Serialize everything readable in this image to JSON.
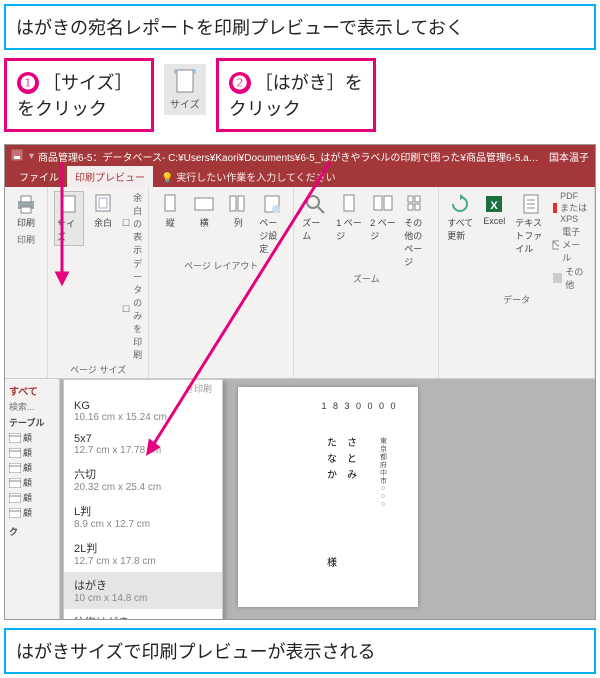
{
  "callouts": {
    "top": "はがきの宛名レポートを印刷プレビューで表示しておく",
    "a1_num": "❶",
    "a1_text": "［サイズ］をクリック",
    "a2_num": "❷",
    "a2_text": "［はがき］をクリック",
    "size_label": "サイズ",
    "bottom": "はがきサイズで印刷プレビューが表示される"
  },
  "titlebar": {
    "title": "商品管理6-5：データベース- C:¥Users¥Kaori¥Documents¥6-5_はがきやラベルの印刷で困った¥商品管理6-5.accdb…",
    "user": "国本温子"
  },
  "tabs": {
    "file": "ファイル",
    "preview": "印刷プレビュー",
    "tellme": "実行したい作業を入力してください"
  },
  "ribbon": {
    "print": "印刷",
    "size": "サイズ",
    "margin": "余白",
    "show_margin": "余白の表示",
    "print_data_only": "データのみを印刷",
    "portrait": "縦",
    "landscape": "横",
    "columns": "列",
    "page_setup": "ページ設定",
    "zoom": "ズーム",
    "one_page": "1 ページ",
    "two_pages": "2 ページ",
    "more_pages": "その他のページ",
    "refresh_all": "すべて更新",
    "excel": "Excel",
    "text_file": "テキストファイル",
    "pdf_xps": "PDF または XPS",
    "email": "電子メール",
    "other": "その他",
    "group_print": "印刷",
    "group_pagesize": "ページ サイズ",
    "group_layout": "ページ レイアウト",
    "group_zoom": "ズーム",
    "group_data": "データ"
  },
  "dd_header": "き印刷",
  "sizes": [
    {
      "name": "KG",
      "dim": "10.16 cm x 15.24 cm"
    },
    {
      "name": "5x7",
      "dim": "12.7 cm x 17.78 cm"
    },
    {
      "name": "六切",
      "dim": "20.32 cm x 25.4 cm"
    },
    {
      "name": "L判",
      "dim": "8.9 cm x 12.7 cm"
    },
    {
      "name": "2L判",
      "dim": "12.7 cm x 17.8 cm"
    },
    {
      "name": "はがき",
      "dim": "10 cm x 14.8 cm"
    },
    {
      "name": "往復はがき",
      "dim": ""
    }
  ],
  "nav": {
    "all": "すべて",
    "search": "検索...",
    "tables": "テーブル",
    "item_prefix": "顧",
    "query": "ク"
  },
  "page": {
    "postal": "1 8 3 0 0 0 0",
    "name1": "たなか",
    "name2": "さとみ",
    "suffix": "様",
    "address": "東京都府中市○○○"
  }
}
